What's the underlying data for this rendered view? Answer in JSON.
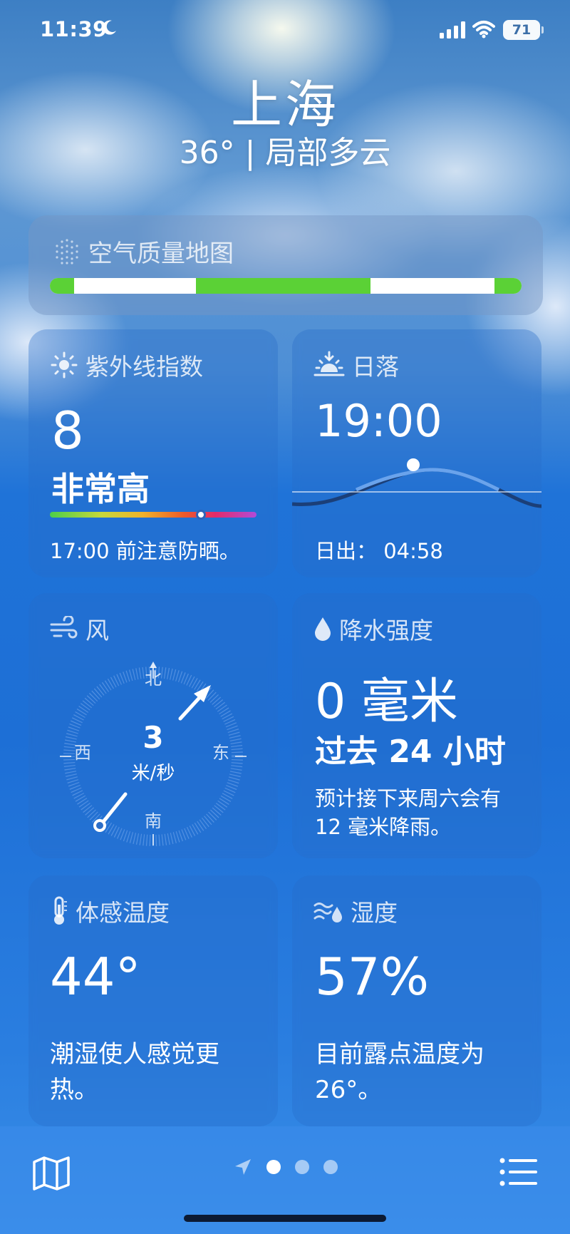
{
  "status_bar": {
    "time": "11:39",
    "battery": "71"
  },
  "location": {
    "city": "上海",
    "summary": "36° | 局部多云"
  },
  "air_quality": {
    "title": "空气质量地图"
  },
  "uv": {
    "title": "紫外线指数",
    "value": "8",
    "level": "非常高",
    "note": "17:00 前注意防晒。",
    "scale_position": 0.73
  },
  "sunset": {
    "title": "日落",
    "time": "19:00",
    "sunrise_label": "日出： 04:58"
  },
  "wind": {
    "title": "风",
    "speed": "3",
    "unit": "米/秒",
    "north": "北",
    "south": "南",
    "east": "东",
    "west": "西"
  },
  "precipitation": {
    "title": "降水强度",
    "amount": "0 毫米",
    "period": "过去 24 小时",
    "note": "预计接下来周六会有 12 毫米降雨。"
  },
  "feels_like": {
    "title": "体感温度",
    "value": "44°",
    "note": "潮湿使人感觉更热。"
  },
  "humidity": {
    "title": "湿度",
    "value": "57%",
    "note": "目前露点温度为 26°。"
  },
  "pager": {
    "count": 3,
    "active": 1
  },
  "colors": {
    "accent_green": "#5bd136",
    "card_bg": "#2c6ec8",
    "sky_top": "#3d7fc4"
  }
}
